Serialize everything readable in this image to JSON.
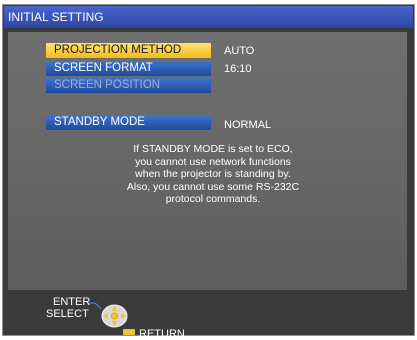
{
  "title": "INITIAL SETTING",
  "menu": [
    {
      "label": "PROJECTION METHOD",
      "value": "AUTO",
      "state": "selected"
    },
    {
      "label": "SCREEN FORMAT",
      "value": "16:10",
      "state": "normal"
    },
    {
      "label": "SCREEN POSITION",
      "value": "",
      "state": "disabled"
    },
    {
      "label": "STANDBY MODE",
      "value": "NORMAL",
      "state": "normal"
    }
  ],
  "note": [
    "If STANDBY MODE is set to ECO,",
    "you cannot use network functions",
    "when the projector is standing by.",
    "Also, you cannot use some RS-232C",
    "protocol commands."
  ],
  "footer": {
    "enter_label": "ENTER",
    "select_label": "SELECT",
    "return_label": "RETURN",
    "icons": {
      "pad": "direction-pad-icon",
      "return": "return-button-icon"
    }
  },
  "colors": {
    "titlebar": "#2d46a6",
    "item": "#2f5fb8",
    "selected": "#f5c52a",
    "panel": "#666666",
    "footer": "#3a3a3a"
  }
}
